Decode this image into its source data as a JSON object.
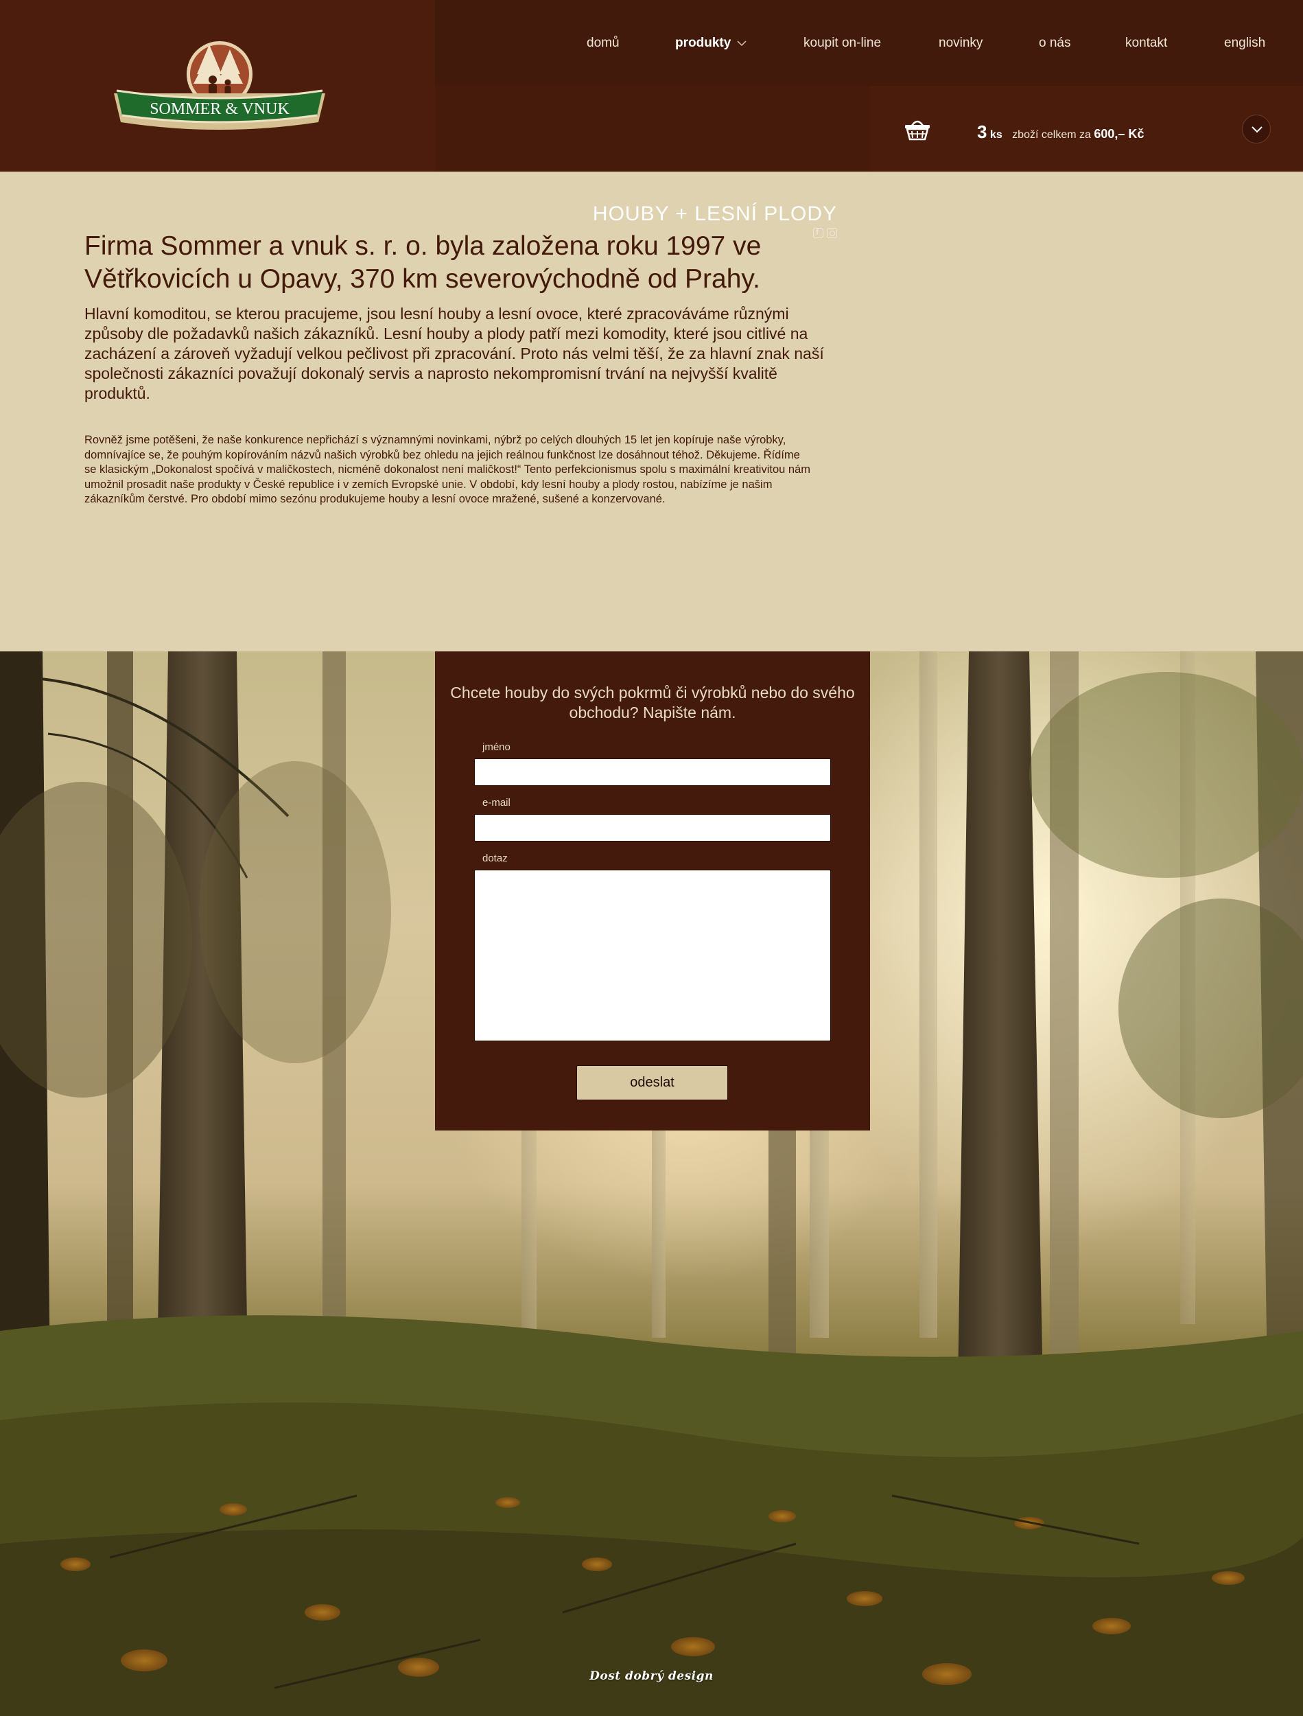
{
  "brand": {
    "logo_text": "SOMMER & VNUK"
  },
  "nav": {
    "items": [
      {
        "label": "domů"
      },
      {
        "label": "produkty"
      },
      {
        "label": "koupit on-line"
      },
      {
        "label": "novinky"
      },
      {
        "label": "o nás"
      },
      {
        "label": "kontakt"
      },
      {
        "label": "english"
      }
    ],
    "active": "produkty"
  },
  "header": {
    "tagline": "HOUBY + LESNÍ PLODY",
    "social": [
      "facebook-icon",
      "instagram-icon"
    ]
  },
  "cart": {
    "count": "3",
    "unit": "ks",
    "text": "zboží celkem za",
    "total": "600,– Kč"
  },
  "intro": {
    "heading": "Firma Sommer a vnuk s. r. o. byla založena roku 1997 ve Větřkovicích u Opavy, 370 km severovýchodně od Prahy.",
    "lead": "Hlavní komoditou, se kterou pracujeme, jsou lesní houby a lesní ovoce, které zpracováváme různými způsoby dle požadavků našich zákazníků. Lesní houby a plody patří mezi komodity, které jsou citlivé na zacházení a zároveň vyžadují velkou pečlivost při zpracování. Proto nás velmi těší, že za hlavní znak naší společnosti zákazníci považují dokonalý servis a naprosto nekompromisní trvání na nejvyšší kvalitě produktů.",
    "body": "Rovněž jsme potěšeni, že naše konkurence nepřichází s významnými novinkami, nýbrž po celých dlouhých 15 let jen kopíruje naše výrobky, domnívajíce se, že pouhým kopírováním názvů našich výrobků bez ohledu na jejich reálnou funkčnost lze dosáhnout téhož. Děkujeme. Řídíme se klasickým „Dokonalost spočívá v maličkostech, nicméně dokonalost není maličkost!“ Tento perfekcionismus spolu s maximální kreativitou nám umožnil prosadit naše produkty v České republice i v zemích Evropské unie. V období, kdy lesní houby a plody rostou, nabízíme je našim zákazníkům čerstvé. Pro období mimo sezónu produkujeme houby a lesní ovoce mražené, sušené a konzervované."
  },
  "contact_form": {
    "title": "Chcete houby do svých pokrmů či výrobků nebo do svého obchodu? Napište nám.",
    "name_label": "jméno",
    "name_value": "",
    "email_label": "e-mail",
    "email_value": "",
    "question_label": "dotaz",
    "question_value": "",
    "submit_label": "odeslat"
  },
  "footer": {
    "credit": "Dost dobrý design"
  },
  "colors": {
    "header_brown": "#4a1c0c",
    "form_brown": "#431a0b",
    "page_beige": "#dfd2b0",
    "logo_green": "#1f6b2c",
    "button_beige": "#d8c9a3"
  }
}
